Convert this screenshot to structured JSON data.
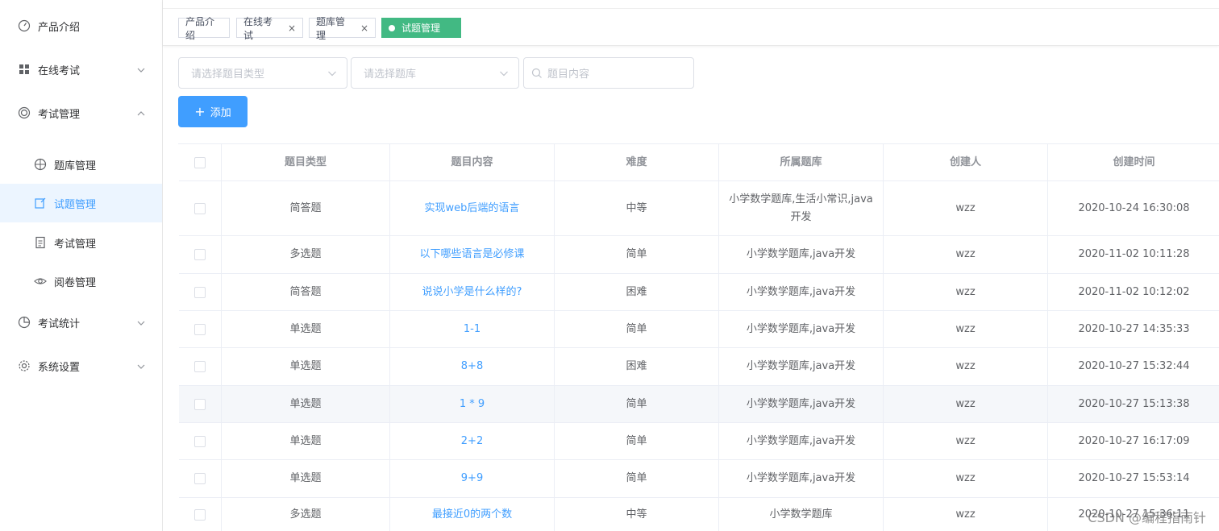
{
  "sidebar": {
    "items": [
      {
        "label": "产品介绍",
        "icon": "gauge-icon"
      },
      {
        "label": "在线考试",
        "icon": "grid-icon",
        "arrow": "down"
      },
      {
        "label": "考试管理",
        "icon": "target-icon",
        "arrow": "up"
      },
      {
        "label": "考试统计",
        "icon": "pie-chart-icon",
        "arrow": "down"
      },
      {
        "label": "系统设置",
        "icon": "gear-icon",
        "arrow": "down"
      }
    ],
    "subitems": [
      {
        "label": "题库管理",
        "icon": "compass-icon"
      },
      {
        "label": "试题管理",
        "icon": "edit-icon",
        "active": true
      },
      {
        "label": "考试管理",
        "icon": "document-icon"
      },
      {
        "label": "阅卷管理",
        "icon": "eye-icon"
      }
    ]
  },
  "tags": [
    {
      "label": "产品介绍"
    },
    {
      "label": "在线考试",
      "close": "×"
    },
    {
      "label": "题库管理",
      "close": "×"
    },
    {
      "label": "试题管理",
      "active": true
    }
  ],
  "filters": {
    "type_placeholder": "请选择题目类型",
    "bank_placeholder": "请选择题库",
    "content_placeholder": "题目内容"
  },
  "add_button": {
    "plus": "+",
    "label": "添加"
  },
  "table": {
    "headers": [
      "题目类型",
      "题目内容",
      "难度",
      "所属题库",
      "创建人",
      "创建时间"
    ],
    "rows": [
      [
        "简答题",
        "实现web后端的语言",
        "中等",
        "小学数学题库,生活小常识,java开发",
        "wzz",
        "2020-10-24 16:30:08"
      ],
      [
        "多选题",
        "以下哪些语言是必修课",
        "简单",
        "小学数学题库,java开发",
        "wzz",
        "2020-11-02 10:11:28"
      ],
      [
        "简答题",
        "说说小学是什么样的?",
        "困难",
        "小学数学题库,java开发",
        "wzz",
        "2020-11-02 10:12:02"
      ],
      [
        "单选题",
        "1-1",
        "简单",
        "小学数学题库,java开发",
        "wzz",
        "2020-10-27 14:35:33"
      ],
      [
        "单选题",
        "8+8",
        "困难",
        "小学数学题库,java开发",
        "wzz",
        "2020-10-27 15:32:44"
      ],
      [
        "单选题",
        "1 * 9",
        "简单",
        "小学数学题库,java开发",
        "wzz",
        "2020-10-27 15:13:38"
      ],
      [
        "单选题",
        "2+2",
        "简单",
        "小学数学题库,java开发",
        "wzz",
        "2020-10-27 16:17:09"
      ],
      [
        "单选题",
        "9+9",
        "简单",
        "小学数学题库,java开发",
        "wzz",
        "2020-10-27 15:53:14"
      ],
      [
        "多选题",
        "最接近0的两个数",
        "中等",
        "小学数学题库",
        "wzz",
        "2020-10-27 15:36:11"
      ]
    ]
  },
  "watermark": "CSDN @编程指南针",
  "colors": {
    "primary": "#409eff",
    "active_tag": "#42b983",
    "active_menu_bg": "#ecf5ff"
  }
}
